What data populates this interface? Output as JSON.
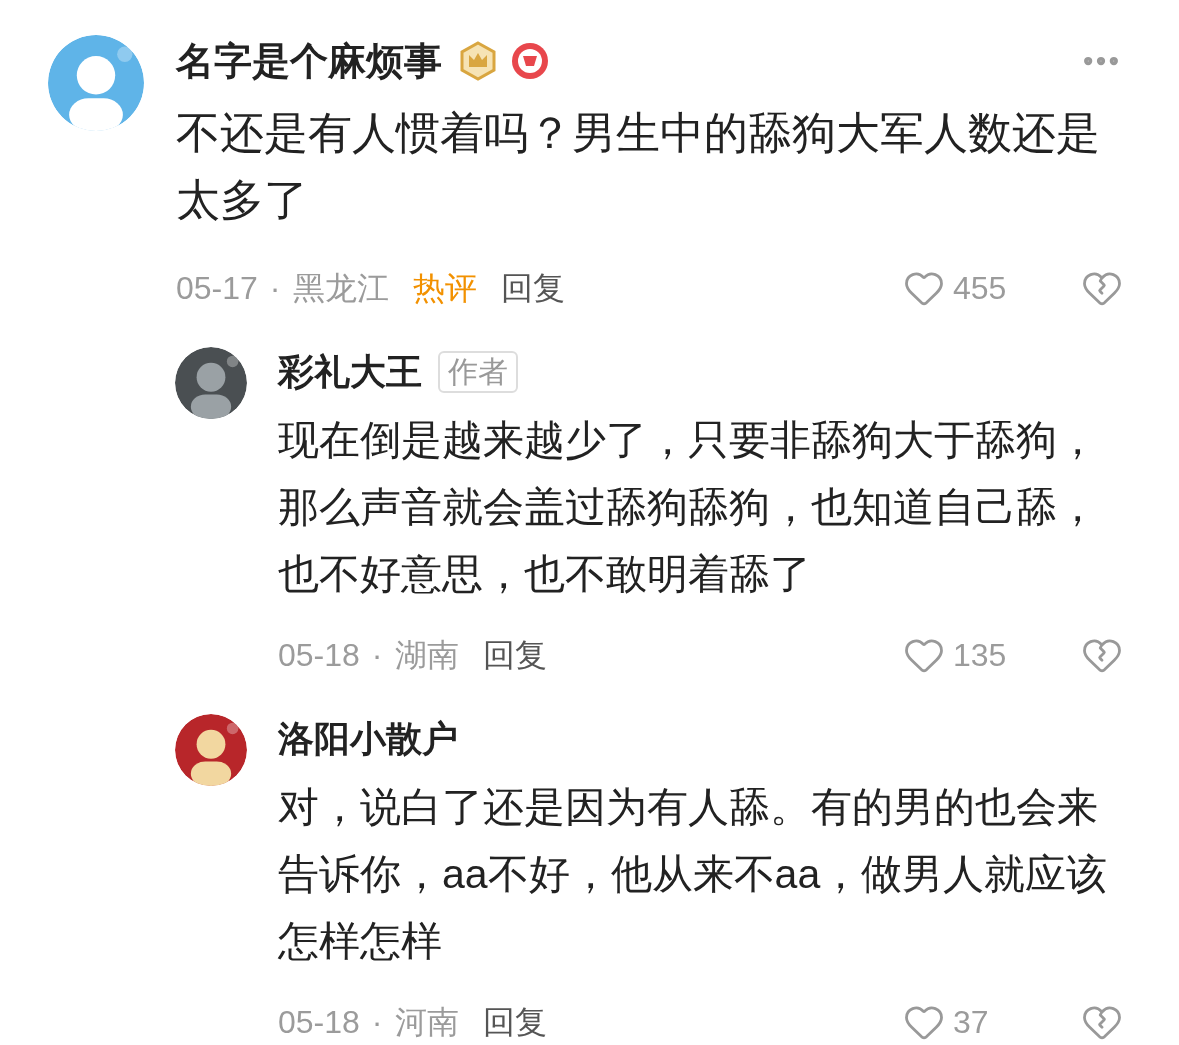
{
  "comment": {
    "author": "名字是个麻烦事",
    "text": "不还是有人惯着吗？男生中的舔狗大军人数还是太多了",
    "date": "05-17",
    "separator": "·",
    "location": "黑龙江",
    "hot_label": "热评",
    "reply_label": "回复",
    "likes": "455"
  },
  "replies": [
    {
      "author": "彩礼大王",
      "author_tag": "作者",
      "text": "现在倒是越来越少了，只要非舔狗大于舔狗，那么声音就会盖过舔狗舔狗，也知道自己舔，也不好意思，也不敢明着舔了",
      "date": "05-18",
      "separator": "·",
      "location": "湖南",
      "reply_label": "回复",
      "likes": "135"
    },
    {
      "author": "洛阳小散户",
      "text": "对，说白了还是因为有人舔。有的男的也会来告诉你，aa不好，他从来不aa，做男人就应该怎样怎样",
      "date": "05-18",
      "separator": "·",
      "location": "河南",
      "reply_label": "回复",
      "likes": "37"
    }
  ]
}
